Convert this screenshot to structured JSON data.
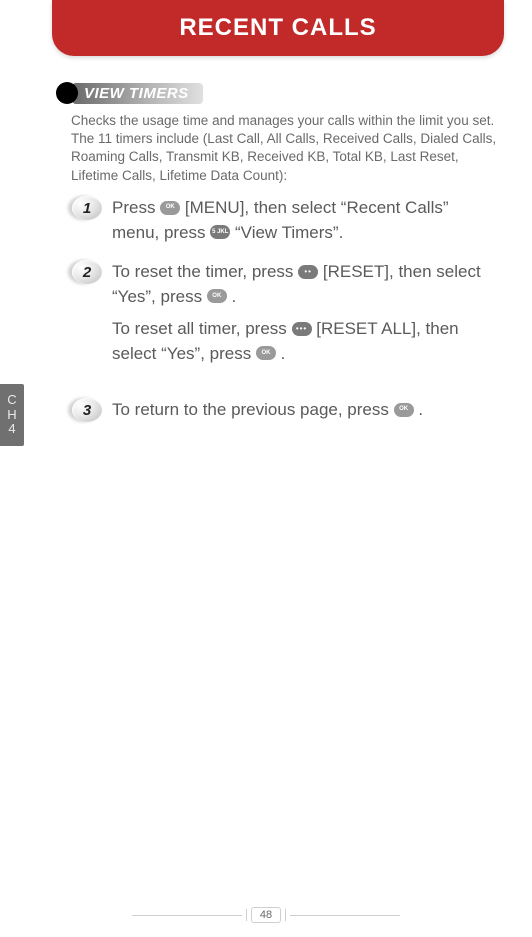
{
  "header": {
    "title": "RECENT CALLS"
  },
  "section": {
    "badge": "VIEW TIMERS"
  },
  "intro": "Checks the usage time and manages your calls within the limit you set. The 11 timers include (Last Call, All Calls, Received Calls, Dialed Calls, Roaming Calls, Transmit KB, Received KB, Total KB, Last Reset, Lifetime Calls, Lifetime Data Count):",
  "steps": {
    "s1": {
      "num": "1",
      "t1a": "Press ",
      "t1b": " [MENU], then select “Recent Calls” menu, press ",
      "t1c": " “View Timers”."
    },
    "s2": {
      "num": "2",
      "t2a": "To reset the timer, press ",
      "t2b": " [RESET], then select “Yes”, press ",
      "t2c": " .",
      "t2d": "To reset all timer, press ",
      "t2e": " [RESET ALL], then select “Yes”, press ",
      "t2f": " ."
    },
    "s3": {
      "num": "3",
      "t3a": "To return to the previous page, press ",
      "t3b": " ."
    }
  },
  "keys": {
    "ok": "OK",
    "dots2": "••",
    "dots3": "•••",
    "five": "5 JKL"
  },
  "sidetab": {
    "l1": "C",
    "l2": "H",
    "l3": "4"
  },
  "page": {
    "num": "48"
  }
}
